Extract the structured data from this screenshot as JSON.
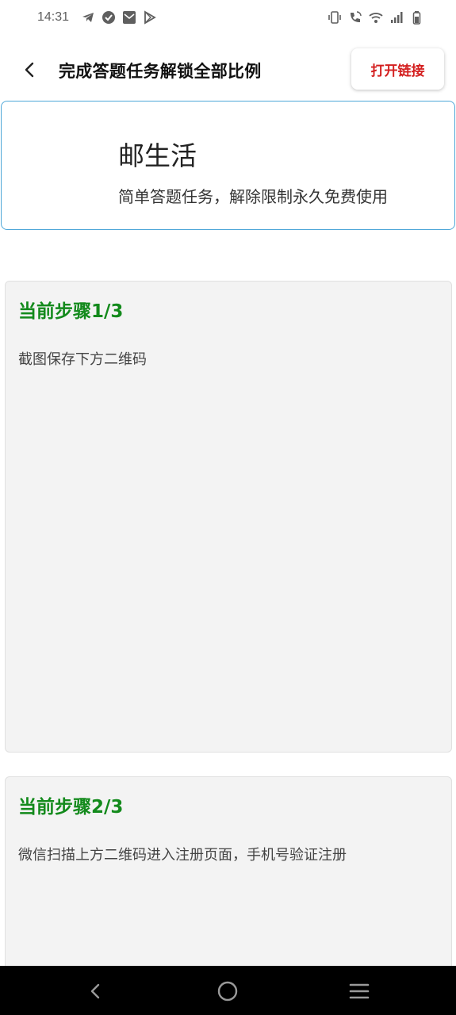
{
  "status_bar": {
    "time": "14:31",
    "left_icons": [
      "telegram-icon",
      "check-circle-icon",
      "mail-icon",
      "play-store-icon"
    ],
    "right_icons": [
      "vibrate-icon",
      "wifi-call-icon",
      "wifi-icon",
      "signal-icon",
      "battery-icon"
    ]
  },
  "header": {
    "back_icon": "chevron-left-icon",
    "title": "完成答题任务解锁全部比例",
    "open_link_label": "打开链接",
    "open_link_color": "#d42020"
  },
  "app_card": {
    "name": "邮生活",
    "description": "简单答题任务，解除限制永久免费使用",
    "border_color": "#4ea7d8"
  },
  "steps": [
    {
      "title": "当前步骤1/3",
      "description": "截图保存下方二维码"
    },
    {
      "title": "当前步骤2/3",
      "description": "微信扫描上方二维码进入注册页面，手机号验证注册"
    }
  ],
  "step_title_color": "#138a1c",
  "nav_bar": {
    "icons": [
      "back-triangle-icon",
      "home-circle-icon",
      "menu-lines-icon"
    ]
  }
}
